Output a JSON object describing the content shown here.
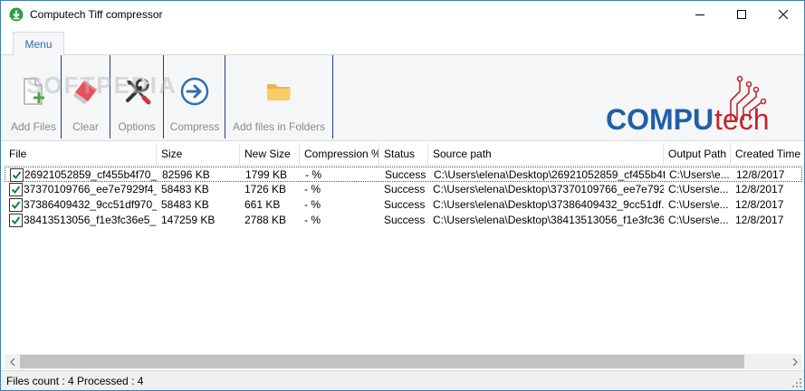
{
  "window": {
    "title": "Computech Tiff compressor"
  },
  "tabs": [
    {
      "label": "Menu"
    }
  ],
  "ribbon": {
    "buttons": [
      {
        "label": "Add Files",
        "icon": "add-file-icon"
      },
      {
        "label": "Clear",
        "icon": "eraser-icon"
      },
      {
        "label": "Options",
        "icon": "tools-icon"
      },
      {
        "label": "Compress",
        "icon": "arrow-circle-icon"
      },
      {
        "label": "Add files in Folders",
        "icon": "folder-icon"
      }
    ],
    "watermark": "SOFTPEDIA",
    "logo": {
      "part1": "COMPU",
      "part2": "tech",
      "color1": "#1f5fa8",
      "color2": "#c0282d"
    }
  },
  "table": {
    "columns": [
      "File",
      "Size",
      "New Size",
      "Compression %",
      "Status",
      "Source path",
      "Output Path",
      "Created Time"
    ],
    "rows": [
      [
        "26921052859_cf455b4f70_...",
        "82596 KB",
        "1799 KB",
        "- %",
        "Success",
        "C:\\Users\\elena\\Desktop\\26921052859_cf455b4f...",
        "C:\\Users\\e...",
        "12/8/2017"
      ],
      [
        "37370109766_ee7e7929f4_...",
        "58483 KB",
        "1726 KB",
        "- %",
        "Success",
        "C:\\Users\\elena\\Desktop\\37370109766_ee7e792...",
        "C:\\Users\\e...",
        "12/8/2017"
      ],
      [
        "37386409432_9cc51df970_...",
        "58483 KB",
        "661 KB",
        "- %",
        "Success",
        "C:\\Users\\elena\\Desktop\\37386409432_9cc51df...",
        "C:\\Users\\e...",
        "12/8/2017"
      ],
      [
        "38413513056_f1e3fc36e5_...",
        "147259 KB",
        "2788 KB",
        "- %",
        "Success",
        "C:\\Users\\elena\\Desktop\\38413513056_f1e3fc36...",
        "C:\\Users\\e...",
        "12/8/2017"
      ]
    ]
  },
  "status": {
    "text": "Files count :  4  Processed :  4"
  },
  "colors": {
    "accent": "#2b6fb6",
    "separator": "#1f3a8a",
    "check": "#1a7f3c"
  }
}
